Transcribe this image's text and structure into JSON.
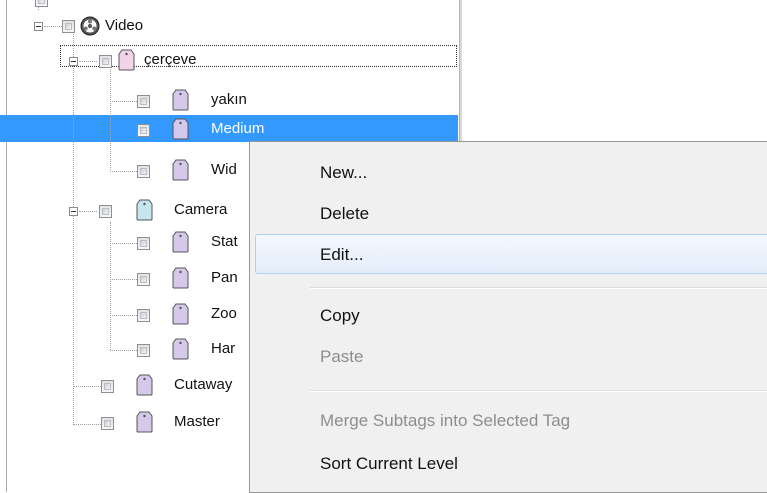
{
  "tree": {
    "root": {
      "label": "Video",
      "icon": "film-reel-icon"
    },
    "items": [
      {
        "label": "çerçeve",
        "tag_color": "pink"
      },
      {
        "label": "yakın",
        "tag_color": "purple"
      },
      {
        "label": "Medium",
        "tag_color": "purple"
      },
      {
        "label": "Wid",
        "tag_color": "purple"
      },
      {
        "label": "Camera",
        "tag_color": "blue"
      },
      {
        "label": "Stat",
        "tag_color": "purple"
      },
      {
        "label": "Pan",
        "tag_color": "purple"
      },
      {
        "label": "Zoo",
        "tag_color": "purple"
      },
      {
        "label": "Har",
        "tag_color": "purple"
      },
      {
        "label": "Cutaway",
        "tag_color": "purple"
      },
      {
        "label": "Master",
        "tag_color": "purple"
      }
    ]
  },
  "context_menu": {
    "items": [
      {
        "label": "New...",
        "enabled": true
      },
      {
        "label": "Delete",
        "enabled": true
      },
      {
        "label": "Edit...",
        "enabled": true,
        "hovered": true
      },
      {
        "label": "Copy",
        "enabled": true
      },
      {
        "label": "Paste",
        "enabled": false
      },
      {
        "label": "Merge Subtags into Selected Tag",
        "enabled": false
      },
      {
        "label": "Sort Current Level",
        "enabled": true
      }
    ]
  },
  "colors": {
    "selection": "#3399ff",
    "menu_background": "#f0f0f0",
    "hover_border": "#aecff7",
    "tag_pink": "#f3d3ea",
    "tag_purple": "#d6c8ea",
    "tag_blue": "#c7e5ef"
  }
}
